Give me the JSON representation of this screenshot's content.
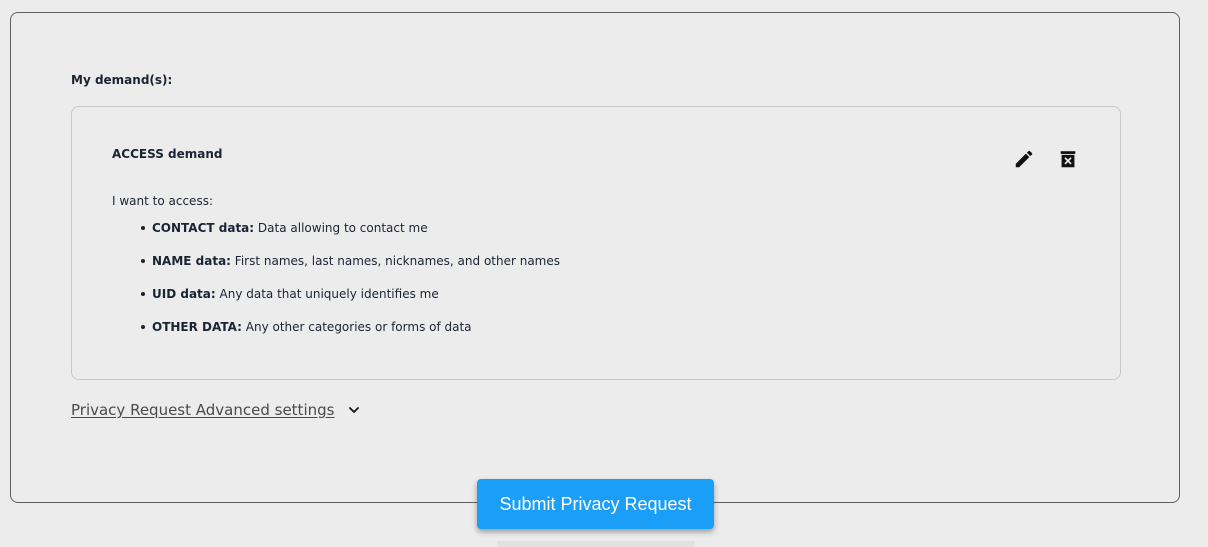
{
  "form": {
    "demands_label": "My demand(s):",
    "demand": {
      "title": "ACCESS demand",
      "intro": "I want to access:",
      "items": [
        {
          "category": "CONTACT data:",
          "description": "Data allowing to contact me"
        },
        {
          "category": "NAME data:",
          "description": "First names, last names, nicknames, and other names"
        },
        {
          "category": "UID data:",
          "description": "Any data that uniquely identifies me"
        },
        {
          "category": "OTHER DATA:",
          "description": "Any other categories or forms of data"
        }
      ],
      "actions": {
        "edit_icon": "pencil-icon",
        "delete_icon": "trash-icon"
      }
    },
    "advanced_settings_label": "Privacy Request Advanced settings",
    "advanced_settings_icon": "chevron-down-icon",
    "submit_label": "Submit Privacy Request"
  },
  "colors": {
    "accent": "#1b9ef7",
    "background": "#ececec",
    "text": "#1b2433"
  }
}
